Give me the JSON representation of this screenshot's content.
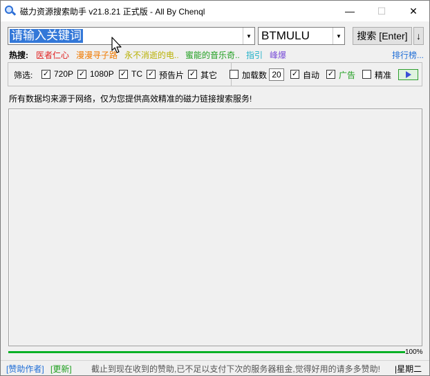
{
  "window": {
    "title": "磁力资源搜索助手 v21.8.21 正式版 - All By Chenql",
    "minimize": "—",
    "maximize": "☐",
    "close": "✕"
  },
  "search": {
    "keyword": "请输入关键词",
    "site": "BTMULU",
    "search_button": "搜索 [Enter]",
    "sort_button": "↓"
  },
  "hot": {
    "label": "热搜:",
    "items": [
      {
        "text": "医者仁心",
        "color": "#e02020"
      },
      {
        "text": "漫漫寻子路",
        "color": "#f07a00"
      },
      {
        "text": "永不消逝的电..",
        "color": "#b8b000"
      },
      {
        "text": "蜜能的音乐奇..",
        "color": "#1e9e1e"
      },
      {
        "text": "指引",
        "color": "#20b0c8"
      },
      {
        "text": "峰爆",
        "color": "#7a4fd8"
      }
    ],
    "rank_link": "排行榜..."
  },
  "filters": {
    "label": "筛选:",
    "options": [
      {
        "label": "720P",
        "checked": true
      },
      {
        "label": "1080P",
        "checked": true
      },
      {
        "label": "TC",
        "checked": true
      },
      {
        "label": "预告片",
        "checked": true
      },
      {
        "label": "其它",
        "checked": true
      }
    ],
    "load_label": "加载数",
    "load_checked": false,
    "load_count": "20",
    "auto_label": "自动",
    "auto_checked": true,
    "ads_label": "广告",
    "ads_checked": true,
    "precise_label": "精准",
    "precise_checked": false,
    "check_mark": "✓"
  },
  "notice": "所有数据均来源于网络，仅为您提供高效精准的磁力链接搜索服务!",
  "progress": {
    "value": 100,
    "text": "100%"
  },
  "status": {
    "sponsor": "[赞助作者]",
    "update": "[更新]",
    "message": "截止到现在收到的赞助,已不足以支付下次的服务器租金,觉得好用的请多多赞助!",
    "weekday": "|星期二"
  },
  "colors": {
    "accent": "#3378d8",
    "link": "#1e6dd6",
    "progress": "#06b025",
    "ads": "#1e9e1e"
  }
}
